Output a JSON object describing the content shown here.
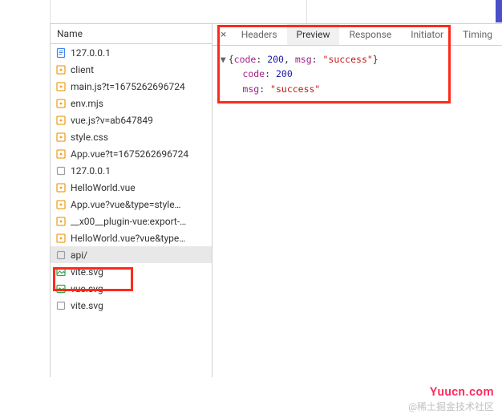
{
  "header": {
    "name_label": "Name"
  },
  "files": [
    {
      "icon": "doc",
      "label": "127.0.0.1"
    },
    {
      "icon": "js",
      "label": "client"
    },
    {
      "icon": "js",
      "label": "main.js?t=1675262696724"
    },
    {
      "icon": "js",
      "label": "env.mjs"
    },
    {
      "icon": "js",
      "label": "vue.js?v=ab647849"
    },
    {
      "icon": "js",
      "label": "style.css"
    },
    {
      "icon": "js",
      "label": "App.vue?t=1675262696724"
    },
    {
      "icon": "box",
      "label": "127.0.0.1"
    },
    {
      "icon": "js",
      "label": "HelloWorld.vue"
    },
    {
      "icon": "js",
      "label": "App.vue?vue&type=style…"
    },
    {
      "icon": "js",
      "label": "__x00__plugin-vue:export-…"
    },
    {
      "icon": "js",
      "label": "HelloWorld.vue?vue&type…"
    },
    {
      "icon": "box",
      "label": "api/",
      "selected": true
    },
    {
      "icon": "img",
      "label": "vite.svg"
    },
    {
      "icon": "img",
      "label": "vue.svg"
    },
    {
      "icon": "box",
      "label": "vite.svg"
    }
  ],
  "tabs": {
    "close": "×",
    "items": [
      {
        "label": "Headers",
        "active": false
      },
      {
        "label": "Preview",
        "active": true
      },
      {
        "label": "Response",
        "active": false
      },
      {
        "label": "Initiator",
        "active": false
      },
      {
        "label": "Timing",
        "active": false
      }
    ]
  },
  "preview": {
    "summary_prefix": "{",
    "summary_code_key": "code",
    "summary_code_val": "200",
    "summary_msg_key": "msg",
    "summary_msg_val": "\"success\"",
    "summary_suffix": "}",
    "line1_key": "code",
    "line1_val": "200",
    "line2_key": "msg",
    "line2_val": "\"success\""
  },
  "watermarks": {
    "brand": "Yuucn.com",
    "credit": "@稀土掘金技术社区"
  },
  "colors": {
    "highlight": "#ff2a1a"
  }
}
